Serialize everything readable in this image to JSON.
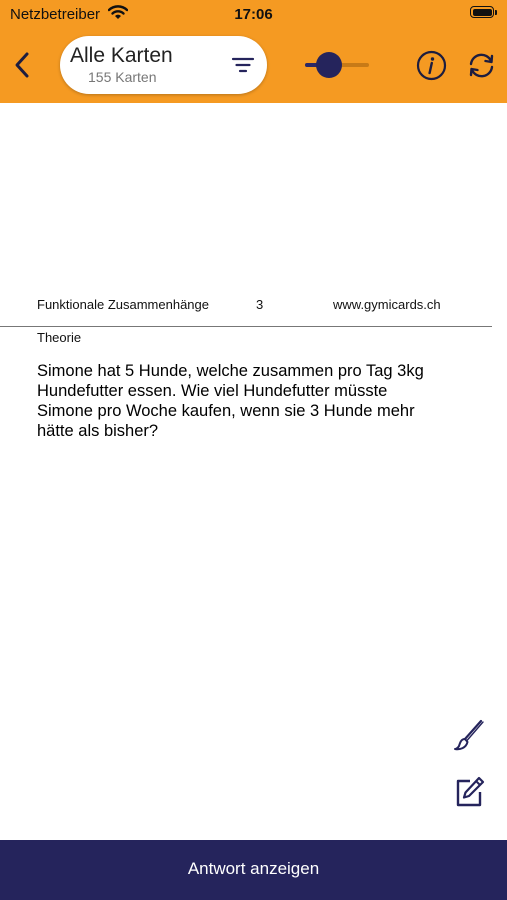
{
  "status_bar": {
    "carrier": "Netzbetreiber",
    "time": "17:06"
  },
  "header": {
    "deck_title": "Alle Karten",
    "card_count": "155 Karten",
    "slider_value": 0.3,
    "accent_color": "#f59a22",
    "primary_color": "#25245c",
    "icons": [
      "back-chevron-icon",
      "filter-icon",
      "info-icon",
      "sync-icon"
    ]
  },
  "card": {
    "topic": "Funktionale Zusammenhänge",
    "number": "3",
    "website": "www.gymicards.ch",
    "category": "Theorie",
    "question_lines": [
      "Simone hat 5 Hunde, welche zusammen pro Tag 3kg",
      "Hundefutter essen. Wie viel Hundefutter müsste",
      "Simone pro Woche kaufen, wenn sie 3 Hunde mehr",
      "hätte als bisher?"
    ]
  },
  "tools": {
    "icons": [
      "brush-icon",
      "edit-icon"
    ]
  },
  "footer": {
    "answer_button": "Antwort anzeigen"
  }
}
